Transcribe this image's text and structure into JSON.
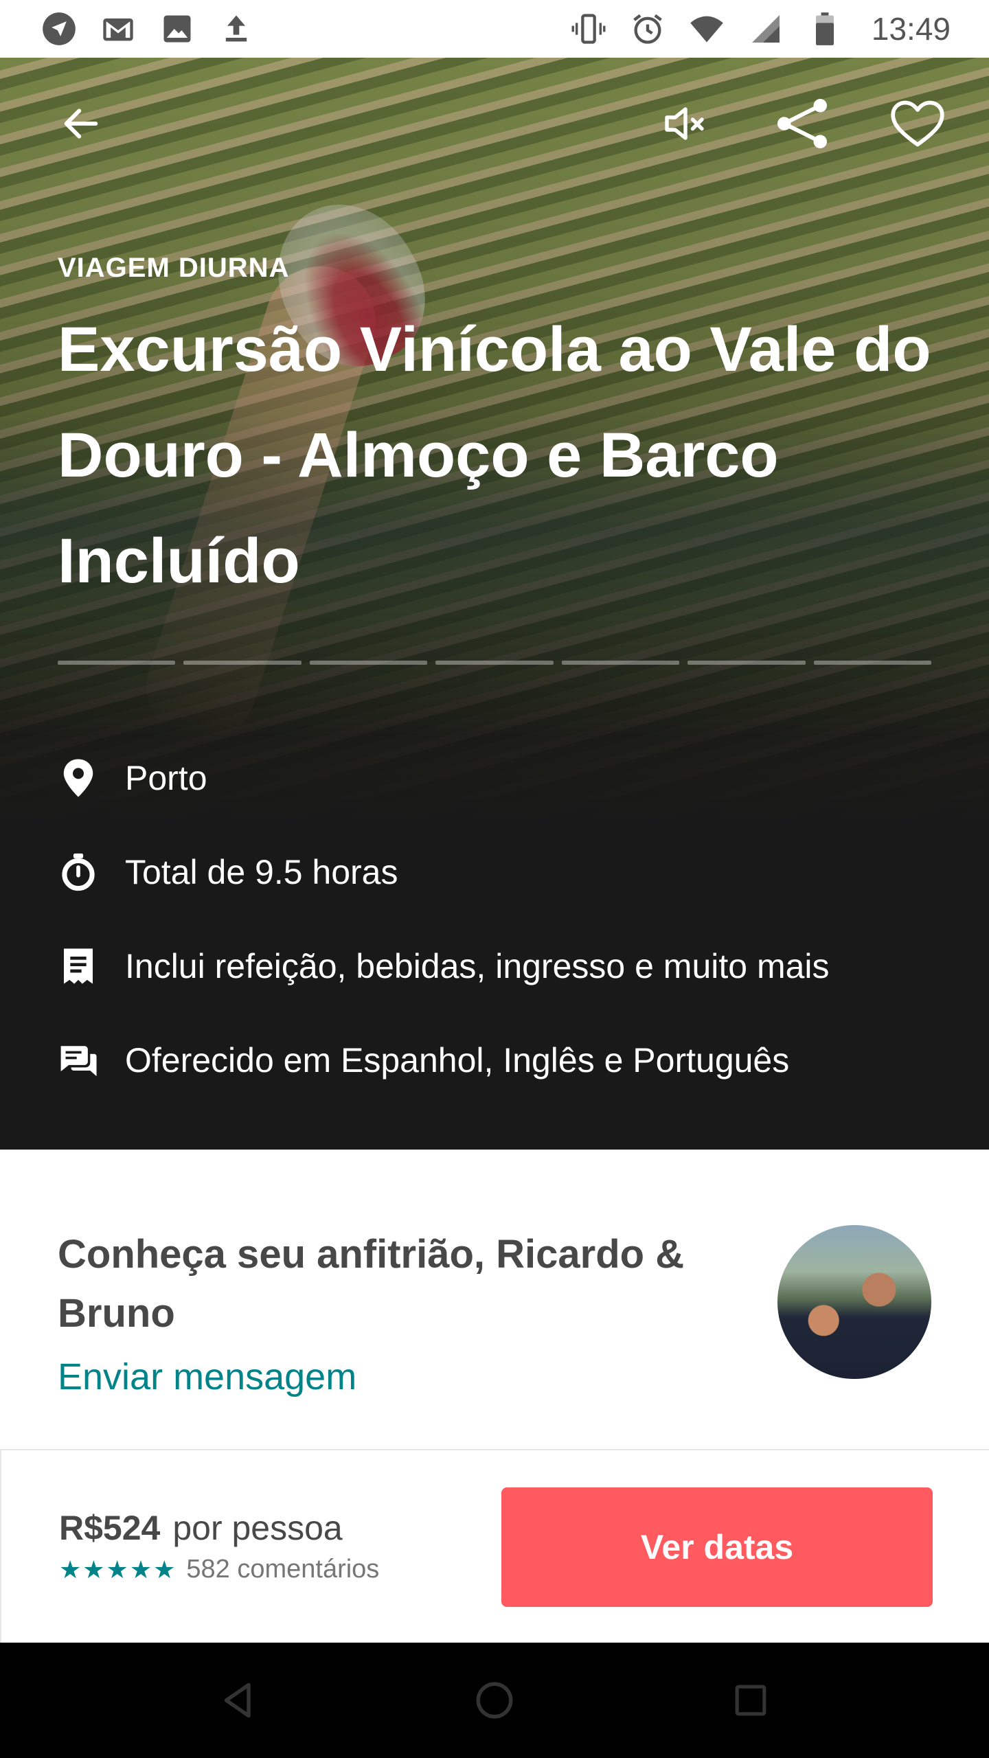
{
  "status_bar": {
    "time": "13:49",
    "left_icons": [
      "navigation-icon",
      "gmail-icon",
      "image-icon",
      "upload-icon"
    ],
    "right_icons": [
      "vibrate-icon",
      "alarm-icon",
      "wifi-icon",
      "signal-icon",
      "battery-icon"
    ]
  },
  "hero": {
    "eyebrow": "VIAGEM DIURNA",
    "title": "Excursão Vinícola ao Vale do Douro - Almoço e Barco Incluído",
    "progress_segments": 7,
    "actions": [
      "back-arrow-icon",
      "mute-icon",
      "share-icon",
      "heart-icon"
    ]
  },
  "features": [
    {
      "icon": "location-pin-icon",
      "text": "Porto"
    },
    {
      "icon": "timer-icon",
      "text": "Total de 9.5 horas"
    },
    {
      "icon": "receipt-icon",
      "text": "Inclui refeição, bebidas, ingresso e muito mais"
    },
    {
      "icon": "chat-bubbles-icon",
      "text": "Oferecido em Espanhol, Inglês e Português"
    }
  ],
  "host": {
    "title": "Conheça seu anfitrião, Ricardo & Bruno",
    "message_link": "Enviar mensagem"
  },
  "booking": {
    "price": "R$524",
    "per_person": "por pessoa",
    "stars": "★★★★★",
    "reviews": "582 comentários",
    "cta_label": "Ver datas"
  },
  "colors": {
    "accent_teal": "#008489",
    "cta_red": "#FF5A5F",
    "hero_dark": "#191919"
  },
  "navbar": [
    "back-triangle-icon",
    "home-circle-icon",
    "recents-square-icon"
  ]
}
